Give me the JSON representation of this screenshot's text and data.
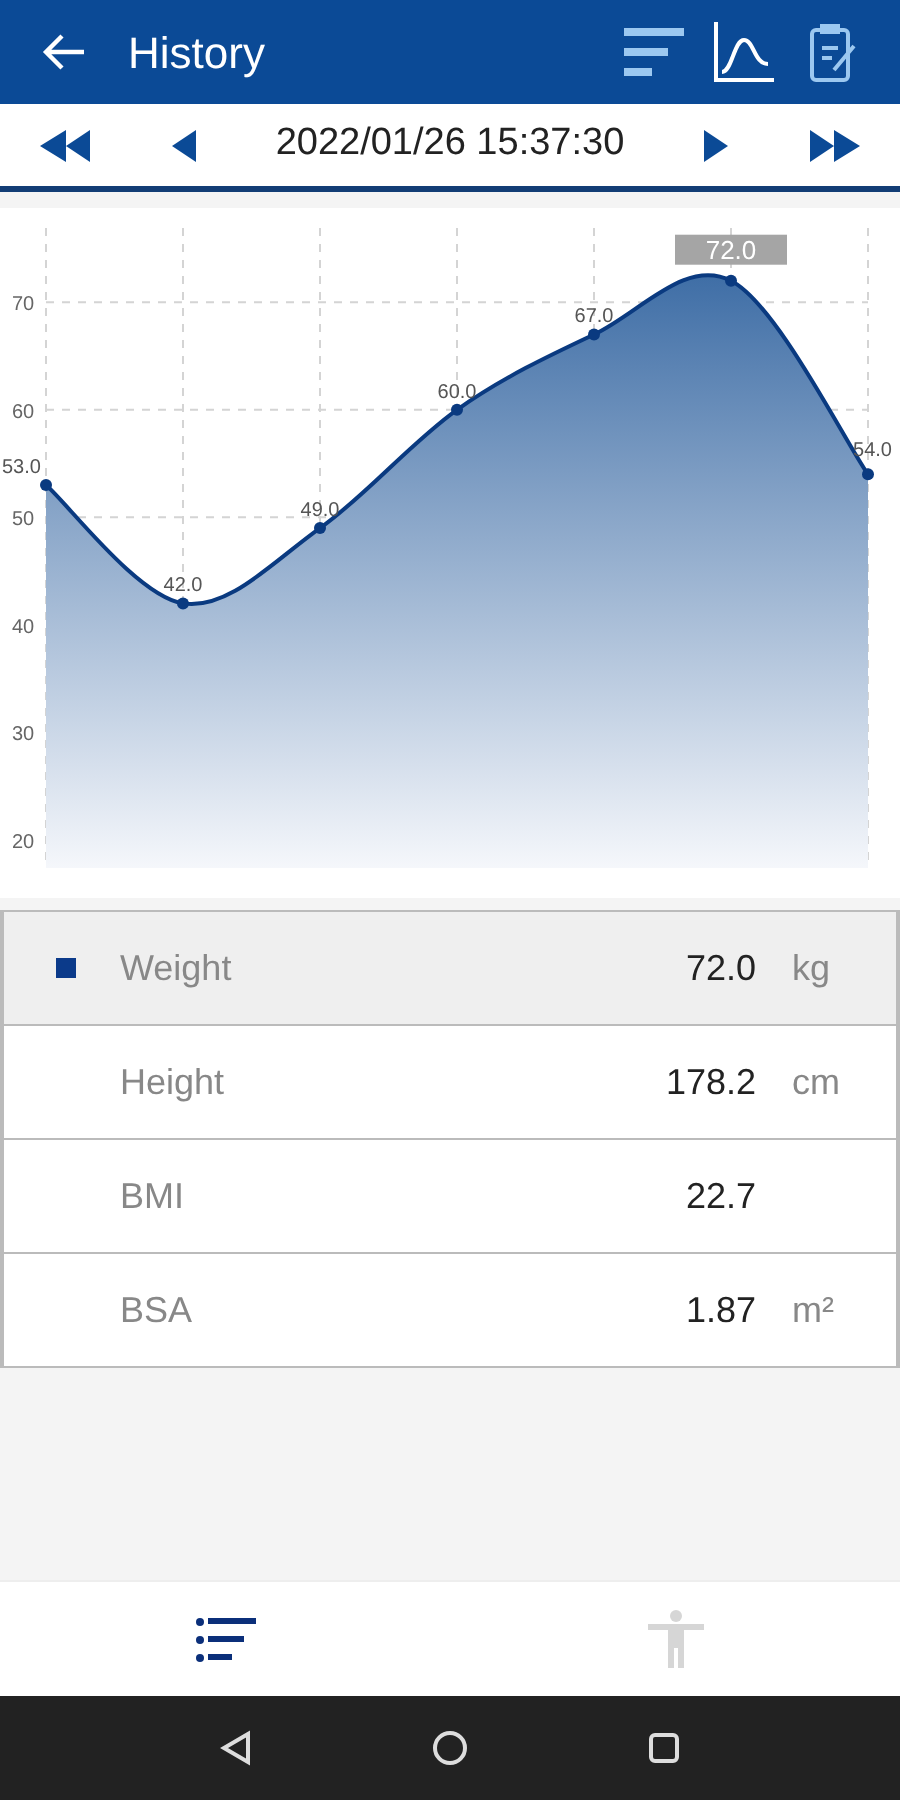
{
  "header": {
    "title": "History"
  },
  "date_bar": {
    "date": "2022/01/26 15:37:30"
  },
  "chart": {
    "chart_data": {
      "type": "area",
      "values": [
        53,
        42,
        49,
        60,
        67,
        72,
        54
      ],
      "ylim": [
        17.4,
        76.9
      ],
      "yticks": [
        20,
        30,
        40,
        50,
        60,
        70
      ],
      "grid": true,
      "data_labels": true,
      "value_labels": [
        "53.0",
        "42.0",
        "49.0",
        "60.0",
        "67.0",
        "72.0",
        "54.0"
      ]
    }
  },
  "measurements": [
    {
      "label": "Weight",
      "value": "72.0",
      "unit": "kg",
      "selected": true
    },
    {
      "label": "Height",
      "value": "178.2",
      "unit": "cm",
      "selected": false
    },
    {
      "label": "BMI",
      "value": "22.7",
      "selected": false
    },
    {
      "label": "BSA",
      "value": "1.87",
      "unit": "m²",
      "selected": false
    }
  ],
  "bottom_tabs": [
    {
      "kind": "list",
      "selected": true
    },
    {
      "kind": "body",
      "selected": false
    }
  ]
}
